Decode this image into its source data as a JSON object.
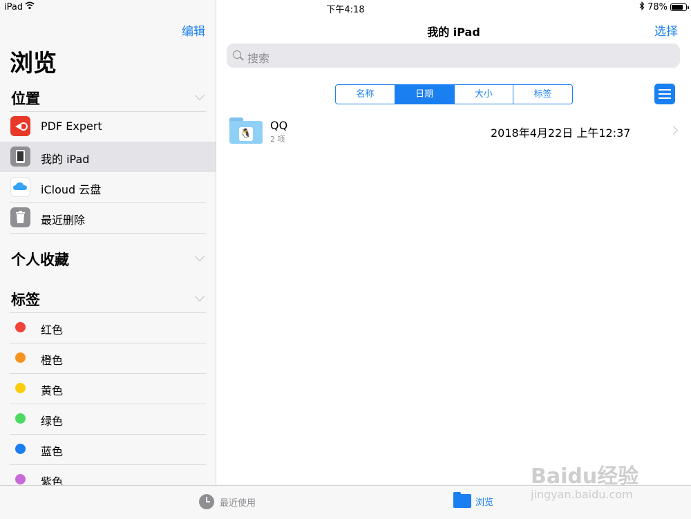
{
  "status": {
    "carrier": "iPad",
    "time": "下午4:18",
    "battery": "78%",
    "battery_level": 0.78
  },
  "sidebar": {
    "edit_label": "编辑",
    "title": "浏览",
    "locations_header": "位置",
    "locations": [
      {
        "label": "PDF Expert",
        "icon": "pdf-expert-icon"
      },
      {
        "label": "我的 iPad",
        "icon": "ipad-icon",
        "selected": true
      },
      {
        "label": "iCloud 云盘",
        "icon": "icloud-icon"
      },
      {
        "label": "最近删除",
        "icon": "trash-icon"
      }
    ],
    "favorites_header": "个人收藏",
    "tags_header": "标签",
    "tags": [
      {
        "label": "红色",
        "color": "#f2413a"
      },
      {
        "label": "橙色",
        "color": "#f7931e"
      },
      {
        "label": "黄色",
        "color": "#fbcc0b"
      },
      {
        "label": "绿色",
        "color": "#4cd964"
      },
      {
        "label": "蓝色",
        "color": "#1a7ff0"
      },
      {
        "label": "紫色",
        "color": "#c86ad8"
      }
    ]
  },
  "main": {
    "title": "我的 iPad",
    "select_label": "选择",
    "search_placeholder": "搜索",
    "sort_tabs": [
      "名称",
      "日期",
      "大小",
      "标签"
    ],
    "sort_selected": "日期",
    "files": [
      {
        "name": "QQ",
        "count": "2 项",
        "date": "2018年4月22日 上午12:37"
      }
    ]
  },
  "tabbar": {
    "recent_label": "最近使用",
    "browse_label": "浏览"
  },
  "watermark": {
    "line1": "Baidu经验",
    "line2": "jingyan.baidu.com"
  }
}
